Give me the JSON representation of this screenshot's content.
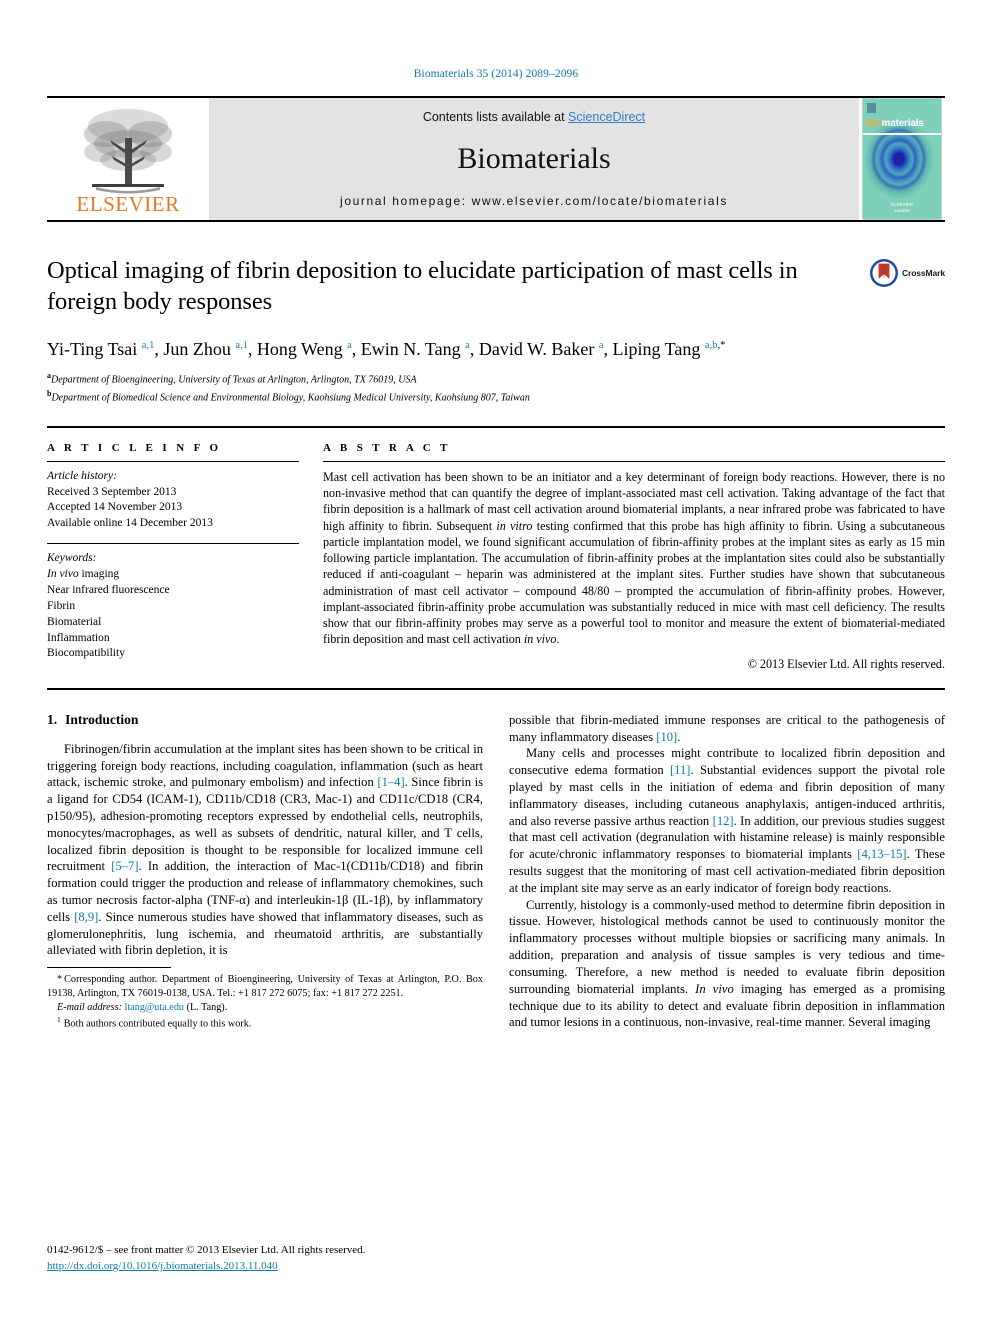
{
  "running_head": "Biomaterials 35 (2014) 2089–2096",
  "masthead": {
    "publisher": "ELSEVIER",
    "contents_prefix": "Contents lists available at ",
    "sciencedirect": "ScienceDirect",
    "journal_title": "Biomaterials",
    "homepage": "journal homepage: www.elsevier.com/locate/biomaterials",
    "cover": {
      "band_first": "Bio",
      "band_rest": "materials",
      "foot_line1": "ELSEVIER",
      "foot_line2": "London"
    }
  },
  "article": {
    "title": "Optical imaging of fibrin deposition to elucidate participation of mast cells in foreign body responses",
    "crossmark_label": "CrossMark",
    "authors": [
      {
        "name": "Yi-Ting Tsai",
        "marks": "a,1"
      },
      {
        "name": "Jun Zhou",
        "marks": "a,1"
      },
      {
        "name": "Hong Weng",
        "marks": "a"
      },
      {
        "name": "Ewin N. Tang",
        "marks": "a"
      },
      {
        "name": "David W. Baker",
        "marks": "a"
      },
      {
        "name": "Liping Tang",
        "marks": "a,b,*"
      }
    ],
    "affiliations": [
      {
        "mark": "a",
        "text": "Department of Bioengineering, University of Texas at Arlington, Arlington, TX 76019, USA"
      },
      {
        "mark": "b",
        "text": "Department of Biomedical Science and Environmental Biology, Kaohsiung Medical University, Kaohsiung 807, Taiwan"
      }
    ]
  },
  "info": {
    "heading": "A R T I C L E  I N F O",
    "history_label": "Article history:",
    "history": [
      "Received 3 September 2013",
      "Accepted 14 November 2013",
      "Available online 14 December 2013"
    ],
    "keywords_label": "Keywords:",
    "keywords": [
      "In vivo imaging",
      "Near infrared fluorescence",
      "Fibrin",
      "Biomaterial",
      "Inflammation",
      "Biocompatibility"
    ]
  },
  "abstract": {
    "heading": "A B S T R A C T",
    "text": "Mast cell activation has been shown to be an initiator and a key determinant of foreign body reactions. However, there is no non-invasive method that can quantify the degree of implant-associated mast cell activation. Taking advantage of the fact that fibrin deposition is a hallmark of mast cell activation around biomaterial implants, a near infrared probe was fabricated to have high affinity to fibrin. Subsequent in vitro testing confirmed that this probe has high affinity to fibrin. Using a subcutaneous particle implantation model, we found significant accumulation of fibrin-affinity probes at the implant sites as early as 15 min following particle implantation. The accumulation of fibrin-affinity probes at the implantation sites could also be substantially reduced if anti-coagulant – heparin was administered at the implant sites. Further studies have shown that subcutaneous administration of mast cell activator – compound 48/80 – prompted the accumulation of fibrin-affinity probes. However, implant-associated fibrin-affinity probe accumulation was substantially reduced in mice with mast cell deficiency. The results show that our fibrin-affinity probes may serve as a powerful tool to monitor and measure the extent of biomaterial-mediated fibrin deposition and mast cell activation in vivo.",
    "copyright": "© 2013 Elsevier Ltd. All rights reserved."
  },
  "body": {
    "section_number": "1.",
    "section_title": "Introduction",
    "left_paragraph": "Fibrinogen/fibrin accumulation at the implant sites has been shown to be critical in triggering foreign body reactions, including coagulation, inflammation (such as heart attack, ischemic stroke, and pulmonary embolism) and infection [1–4]. Since fibrin is a ligand for CD54 (ICAM-1), CD11b/CD18 (CR3, Mac-1) and CD11c/CD18 (CR4, p150/95), adhesion-promoting receptors expressed by endothelial cells, neutrophils, monocytes/macrophages, as well as subsets of dendritic, natural killer, and T cells, localized fibrin deposition is thought to be responsible for localized immune cell recruitment [5–7]. In addition, the interaction of Mac-1(CD11b/CD18) and fibrin formation could trigger the production and release of inflammatory chemokines, such as tumor necrosis factor-alpha (TNF-α) and interleukin-1β (IL-1β), by inflammatory cells [8,9]. Since numerous studies have showed that inflammatory diseases, such as glomerulonephritis, lung ischemia, and rheumatoid arthritis, are substantially alleviated with fibrin depletion, it is",
    "right_paragraph_1": "possible that fibrin-mediated immune responses are critical to the pathogenesis of many inflammatory diseases [10].",
    "right_paragraph_2": "Many cells and processes might contribute to localized fibrin deposition and consecutive edema formation [11]. Substantial evidences support the pivotal role played by mast cells in the initiation of edema and fibrin deposition of many inflammatory diseases, including cutaneous anaphylaxis, antigen-induced arthritis, and also reverse passive arthus reaction [12]. In addition, our previous studies suggest that mast cell activation (degranulation with histamine release) is mainly responsible for acute/chronic inflammatory responses to biomaterial implants [4,13–15]. These results suggest that the monitoring of mast cell activation-mediated fibrin deposition at the implant site may serve as an early indicator of foreign body reactions.",
    "right_paragraph_3": "Currently, histology is a commonly-used method to determine fibrin deposition in tissue. However, histological methods cannot be used to continuously monitor the inflammatory processes without multiple biopsies or sacrificing many animals. In addition, preparation and analysis of tissue samples is very tedious and time-consuming. Therefore, a new method is needed to evaluate fibrin deposition surrounding biomaterial implants. In vivo imaging has emerged as a promising technique due to its ability to detect and evaluate fibrin deposition in inflammation and tumor lesions in a continuous, non-invasive, real-time manner. Several imaging"
  },
  "footnotes": {
    "corresponding": "Corresponding author. Department of Bioengineering, University of Texas at Arlington, P.O. Box 19138, Arlington, TX 76019-0138, USA. Tel.: +1 817 272 6075; fax: +1 817 272 2251.",
    "email_label": "E-mail address:",
    "email": "ltang@uta.edu",
    "email_suffix": "(L. Tang).",
    "equal_contribution": "Both authors contributed equally to this work."
  },
  "page_footer": {
    "issn_line": "0142-9612/$ – see front matter © 2013 Elsevier Ltd. All rights reserved.",
    "doi": "http://dx.doi.org/10.1016/j.biomaterials.2013.11.040"
  },
  "colors": {
    "link": "#0b7ba8",
    "sciencedirect": "#2a7fc9",
    "elsevier_orange": "#E87722",
    "band_gray": "#e3e3e3"
  }
}
